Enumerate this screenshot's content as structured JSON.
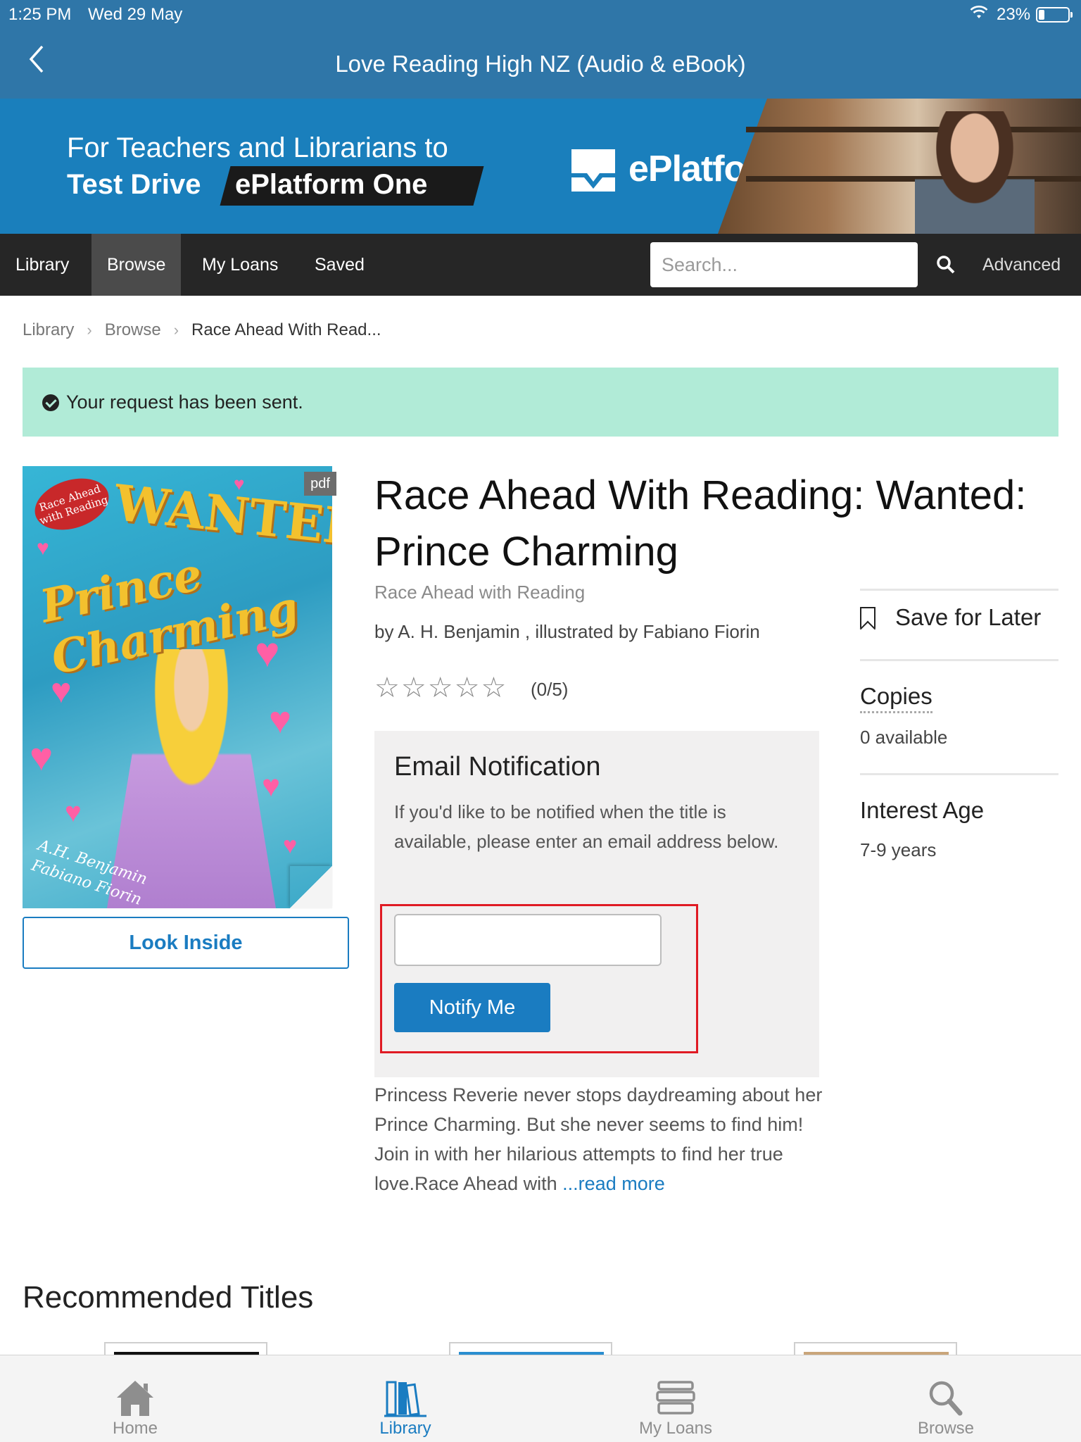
{
  "status": {
    "time": "1:25 PM",
    "date": "Wed 29 May",
    "battery": "23%"
  },
  "header": {
    "title": "Love Reading High NZ (Audio & eBook)"
  },
  "banner": {
    "line1": "For Teachers and Librarians to",
    "line2a": "Test Drive",
    "line2b": "ePlatform One",
    "brand": "ePlatform"
  },
  "nav": {
    "items": [
      "Library",
      "Browse",
      "My Loans",
      "Saved"
    ],
    "active": "Browse",
    "search_placeholder": "Search...",
    "advanced": "Advanced"
  },
  "breadcrumb": [
    "Library",
    "Browse",
    "Race Ahead With Read..."
  ],
  "alert": {
    "message": "Your request has been sent."
  },
  "cover": {
    "format": "pdf",
    "badge": "Race Ahead with Reading",
    "art_title": "WANTED:",
    "art_subtitle": "Prince Charming",
    "art_author1": "A.H. Benjamin",
    "art_author2": "Fabiano Fiorin"
  },
  "look_inside": "Look Inside",
  "book": {
    "title": "Race Ahead With Reading: Wanted: Prince Charming",
    "series": "Race Ahead with Reading",
    "byline": "by A. H. Benjamin , illustrated by Fabiano Fiorin",
    "rating_text": "(0/5)",
    "rating_value": 0,
    "description": "Princess Reverie never stops daydreaming about her Prince Charming. But she never seems to find him! Join in with her hilarious attempts to find her true love.Race Ahead with ",
    "read_more": "...read more"
  },
  "notify": {
    "heading": "Email Notification",
    "text": "If you'd like to be notified when the title is available, please enter an email address below.",
    "email_value": "",
    "button": "Notify Me"
  },
  "sidebar": {
    "save_later": "Save for Later",
    "copies_label": "Copies",
    "copies_value": "0 available",
    "age_label": "Interest Age",
    "age_value": "7-9 years"
  },
  "recommended": {
    "title": "Recommended Titles"
  },
  "tabs": [
    {
      "label": "Home",
      "icon": "home-icon"
    },
    {
      "label": "Library",
      "icon": "library-icon",
      "active": true
    },
    {
      "label": "My Loans",
      "icon": "books-stack-icon"
    },
    {
      "label": "Browse",
      "icon": "search-icon"
    }
  ],
  "colors": {
    "primary": "#2f76a8",
    "accent": "#1a7cc1",
    "alert_bg": "#b1ebd7",
    "nav_bg": "#262626",
    "highlight": "#e01b24"
  }
}
